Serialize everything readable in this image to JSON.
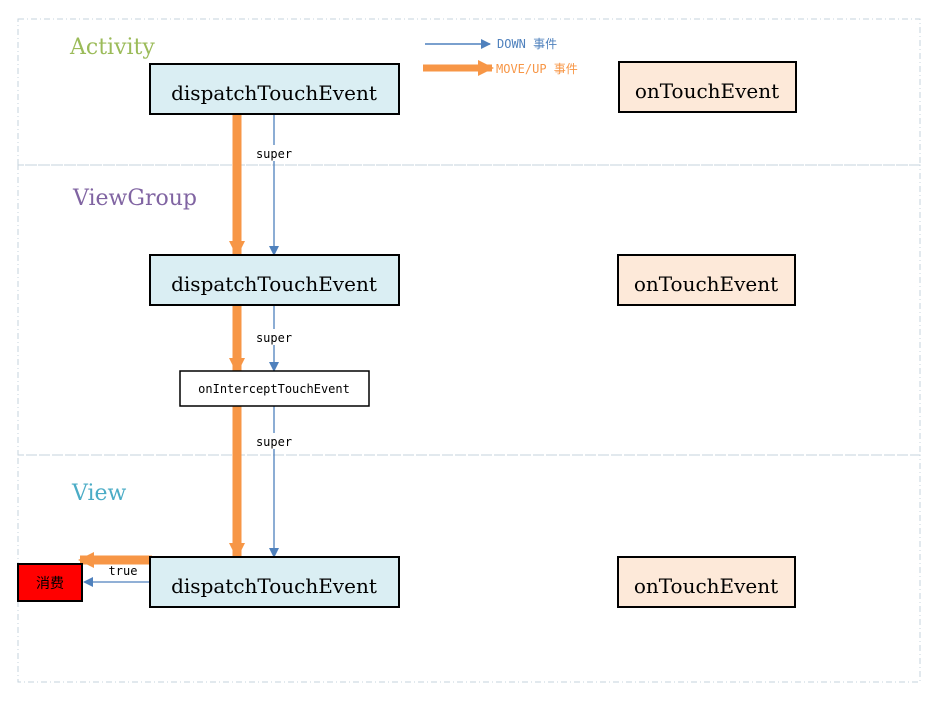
{
  "legend": {
    "down": "DOWN 事件",
    "move_up": "MOVE/UP 事件"
  },
  "layers": {
    "activity": "Activity",
    "viewgroup": "ViewGroup",
    "view": "View"
  },
  "nodes": {
    "activity_dispatch": "dispatchTouchEvent",
    "activity_ontouch": "onTouchEvent",
    "viewgroup_dispatch": "dispatchTouchEvent",
    "viewgroup_ontouch": "onTouchEvent",
    "intercept": "onInterceptTouchEvent",
    "view_dispatch": "dispatchTouchEvent",
    "view_ontouch": "onTouchEvent",
    "consume": "消费"
  },
  "labels": {
    "super1": "super",
    "super2": "super",
    "super3": "super",
    "true": "true"
  },
  "colors": {
    "down": "#4f81bd",
    "move_up": "#f79646",
    "dispatch_fill": "#daeef3",
    "ontouch_fill": "#fde9d9",
    "consume_fill": "#ff0000",
    "activity": "#9bbb59",
    "viewgroup": "#8064a2",
    "view": "#4bacc6"
  }
}
